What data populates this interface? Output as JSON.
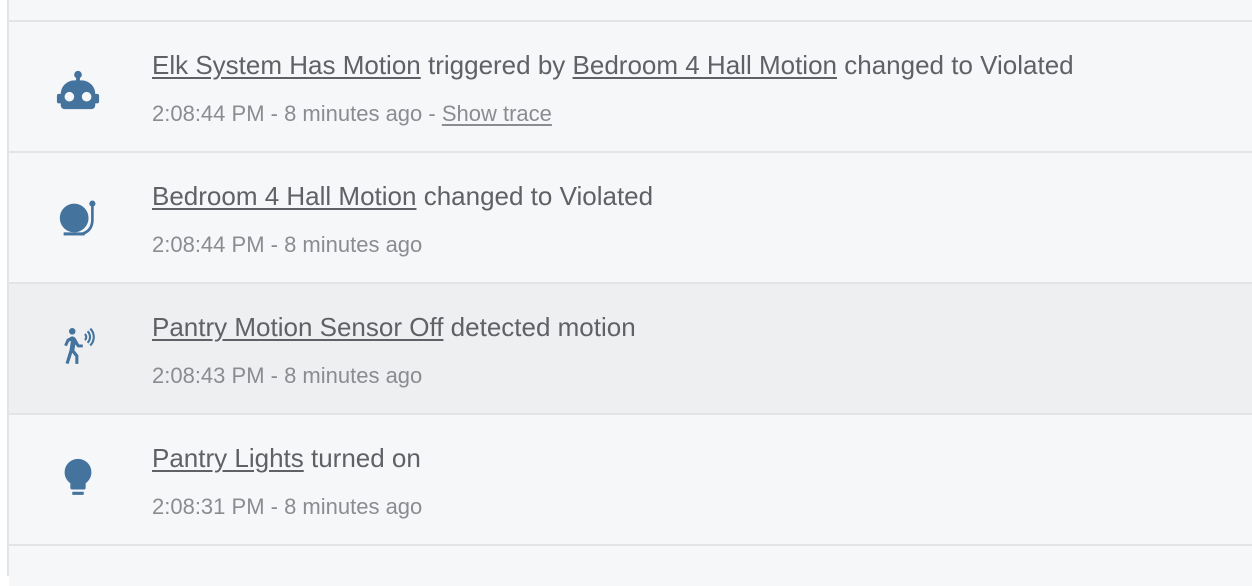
{
  "colors": {
    "icon": "#44739e",
    "text_primary": "#5f6166",
    "text_secondary": "#8a8c91",
    "row_bg": "#f6f7f9",
    "row_hover_bg": "#eeeff1",
    "divider": "#e3e4e6"
  },
  "entries": [
    {
      "icon": "robot-icon",
      "name": "Elk System Has Motion",
      "message_pre": "triggered by",
      "context_name": "Bedroom 4 Hall Motion",
      "message": "changed to Violated",
      "time": "2:08:44 PM",
      "separator": " - ",
      "relative": "8 minutes ago",
      "trace_separator": " - ",
      "trace_label": "Show trace"
    },
    {
      "icon": "bell-icon",
      "name": "Bedroom 4 Hall Motion",
      "message": "changed to Violated",
      "time": "2:08:44 PM",
      "separator": " - ",
      "relative": "8 minutes ago"
    },
    {
      "icon": "motion-sensor-icon",
      "name": "Pantry Motion Sensor Off",
      "message": "detected motion",
      "time": "2:08:43 PM",
      "separator": " - ",
      "relative": "8 minutes ago"
    },
    {
      "icon": "lightbulb-icon",
      "name": "Pantry Lights",
      "message": "turned on",
      "time": "2:08:31 PM",
      "separator": " - ",
      "relative": "8 minutes ago"
    }
  ]
}
